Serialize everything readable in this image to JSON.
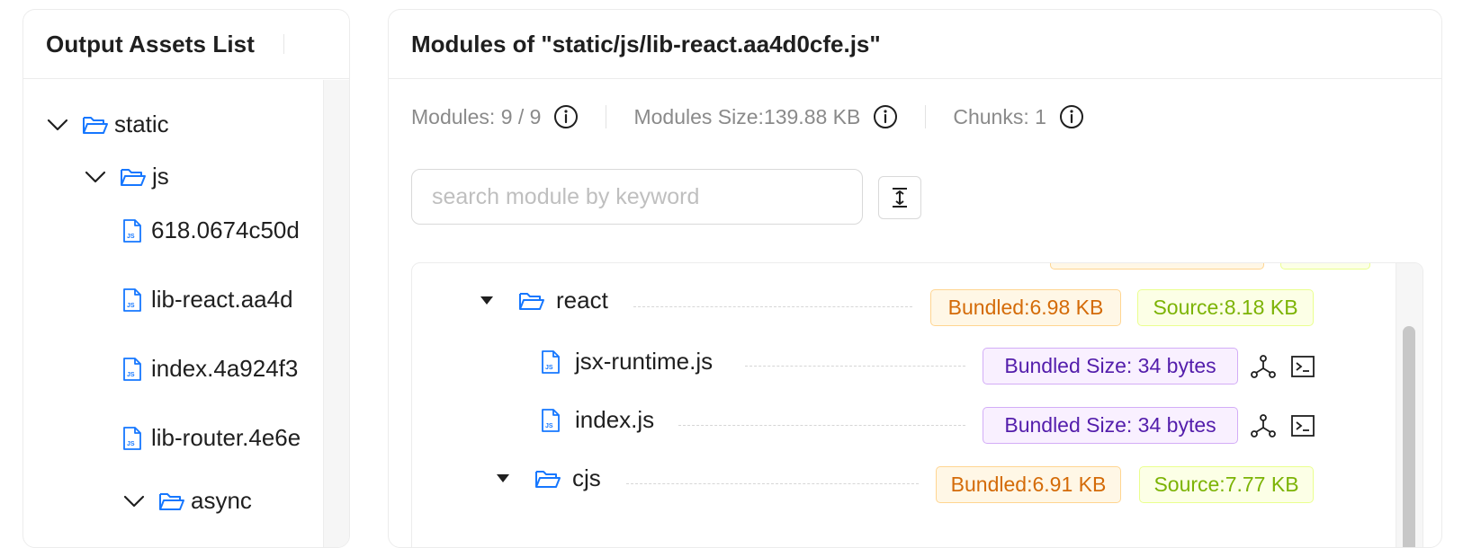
{
  "left_panel": {
    "title": "Output Assets List",
    "tree": {
      "root_folder": "static",
      "sub_folder": "js",
      "files": [
        "618.0674c50d",
        "lib-react.aa4d",
        "index.4a924f3",
        "lib-router.4e6e"
      ],
      "next_folder_partial": "async"
    }
  },
  "right_panel": {
    "title": "Modules of \"static/js/lib-react.aa4d0cfe.js\"",
    "stats": {
      "modules": "Modules: 9 / 9",
      "modules_size": "Modules Size:139.88 KB",
      "chunks": "Chunks: 1"
    },
    "search": {
      "placeholder": "search module by keyword",
      "value": ""
    },
    "module_tree": {
      "react": {
        "name": "react",
        "bundled": "Bundled:6.98 KB",
        "source": "Source:8.18 KB"
      },
      "jsx_runtime": {
        "name": "jsx-runtime.js",
        "size": "Bundled Size: 34 bytes"
      },
      "index": {
        "name": "index.js",
        "size": "Bundled Size: 34 bytes"
      },
      "cjs": {
        "name": "cjs",
        "bundled": "Bundled:6.91 KB",
        "source": "Source:7.77 KB"
      }
    }
  },
  "colors": {
    "folder_icon": "#1677ff",
    "bundled_tag_text": "#d46b08",
    "source_tag_text": "#7cb305",
    "size_tag_text": "#531dab"
  },
  "icons": [
    "chevron-down-icon",
    "folder-open-icon",
    "js-file-icon",
    "info-icon",
    "expand-vertical-icon",
    "module-graph-icon",
    "terminal-icon",
    "caret-down-icon"
  ]
}
